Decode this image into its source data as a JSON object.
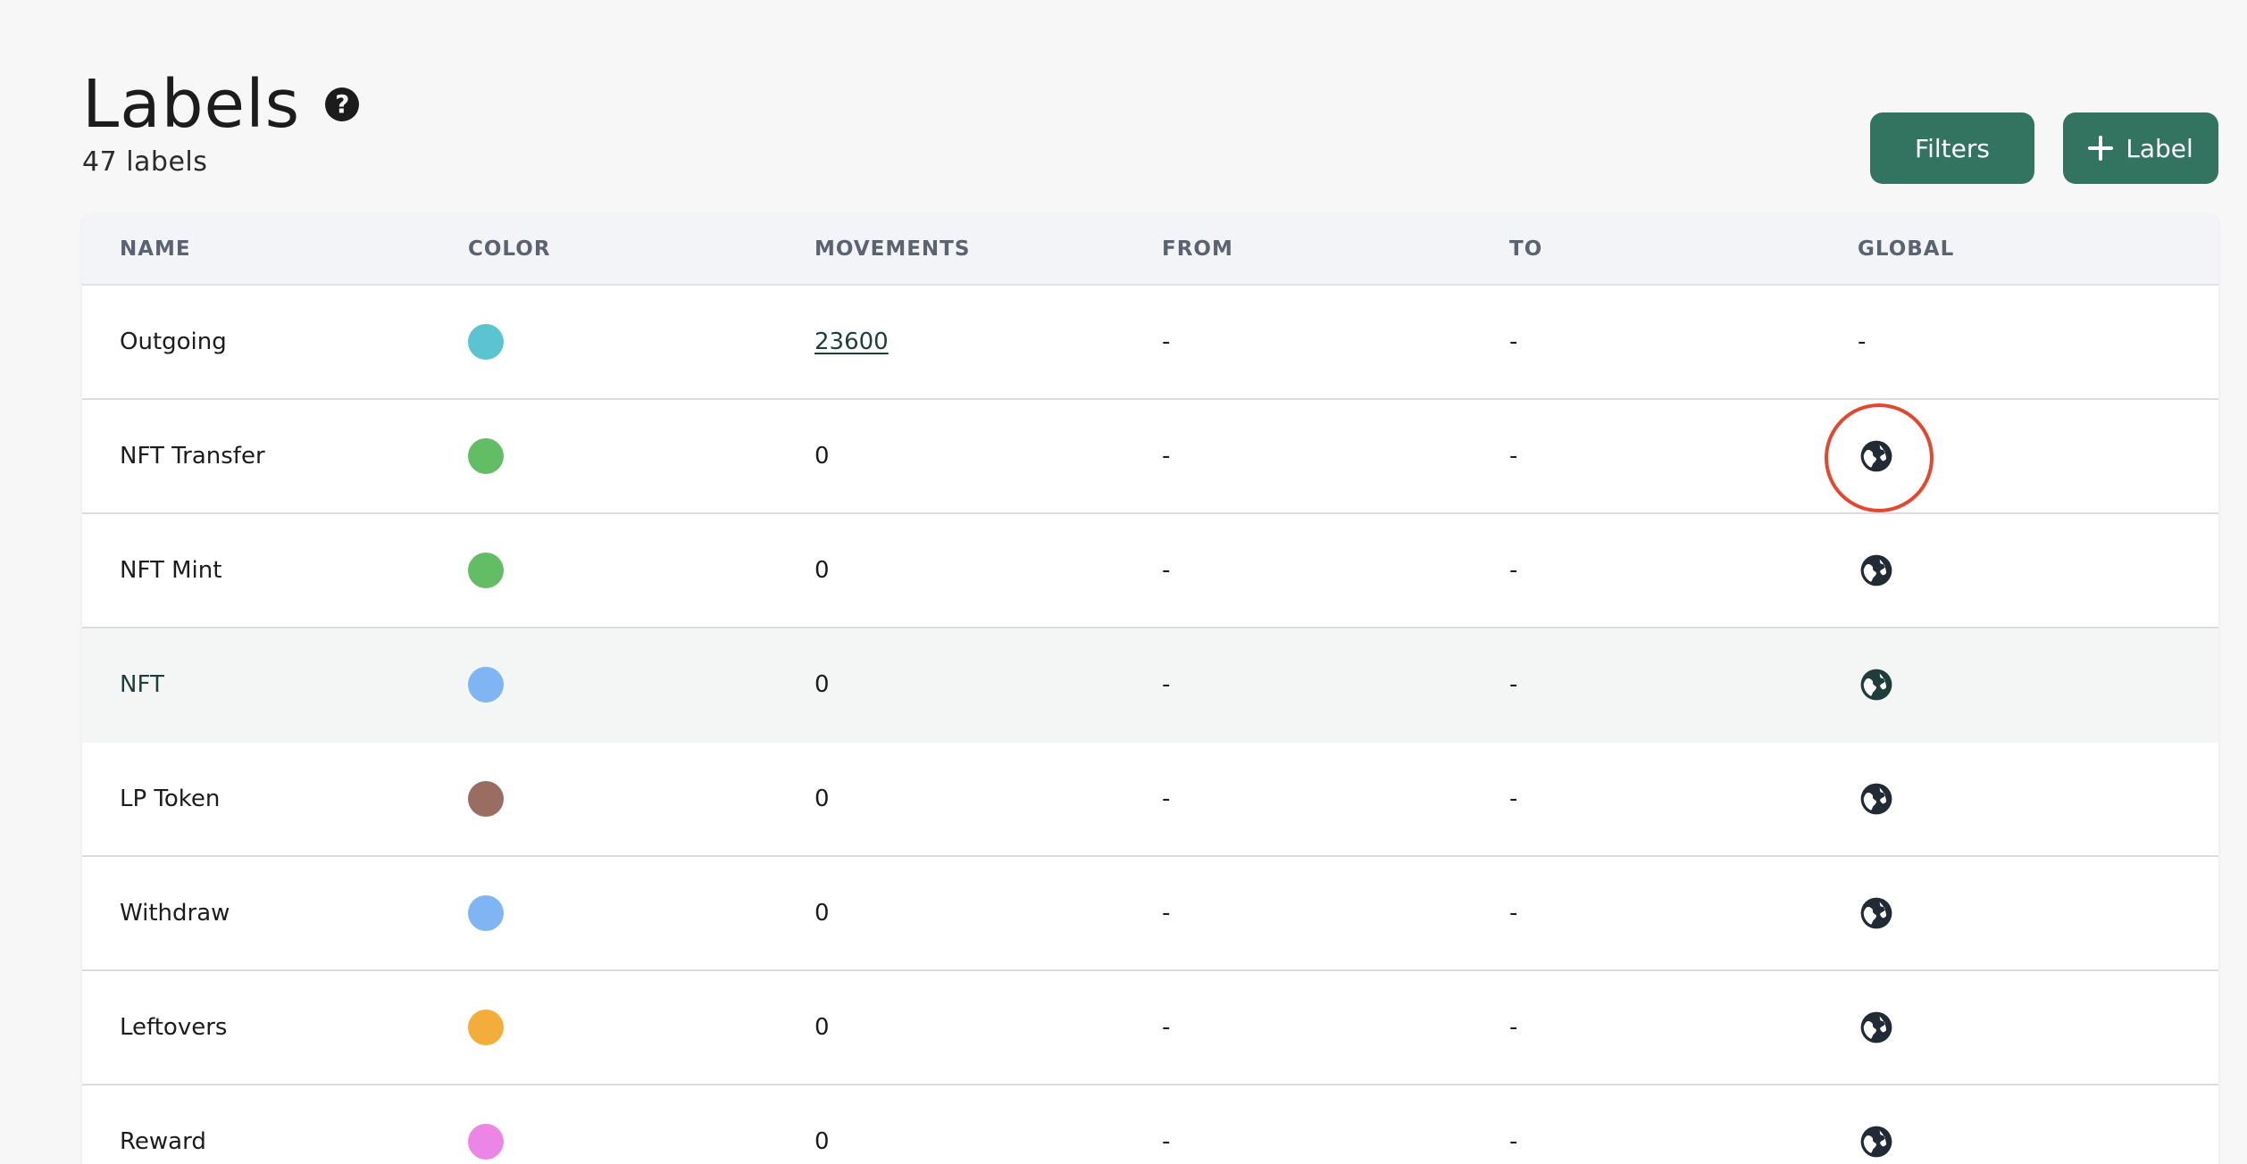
{
  "header": {
    "title": "Labels",
    "count_text": "47 labels"
  },
  "actions": {
    "filters_label": "Filters",
    "add_label": "Label"
  },
  "table": {
    "columns": [
      "NAME",
      "COLOR",
      "MOVEMENTS",
      "FROM",
      "TO",
      "GLOBAL"
    ],
    "rows": [
      {
        "name": "Outgoing",
        "color": "#5bc4d1",
        "movements": "23600",
        "from": "-",
        "to": "-",
        "global": "-"
      },
      {
        "name": "NFT Transfer",
        "color": "#63bd64",
        "movements": "0",
        "from": "-",
        "to": "-",
        "global": "globe-icon"
      },
      {
        "name": "NFT Mint",
        "color": "#63bd64",
        "movements": "0",
        "from": "-",
        "to": "-",
        "global": "globe-icon"
      },
      {
        "name": "NFT",
        "color": "#7fb5f2",
        "movements": "0",
        "from": "-",
        "to": "-",
        "global": "globe-icon"
      },
      {
        "name": "LP Token",
        "color": "#9a6d63",
        "movements": "0",
        "from": "-",
        "to": "-",
        "global": "globe-icon"
      },
      {
        "name": "Withdraw",
        "color": "#7fb5f2",
        "movements": "0",
        "from": "-",
        "to": "-",
        "global": "globe-icon"
      },
      {
        "name": "Leftovers",
        "color": "#f2ad3a",
        "movements": "0",
        "from": "-",
        "to": "-",
        "global": "globe-icon"
      },
      {
        "name": "Reward",
        "color": "#ec86e4",
        "movements": "0",
        "from": "-",
        "to": "-",
        "global": "globe-icon"
      }
    ]
  },
  "colors": {
    "primary_button": "#337461",
    "highlight_ring": "#e2472f"
  }
}
